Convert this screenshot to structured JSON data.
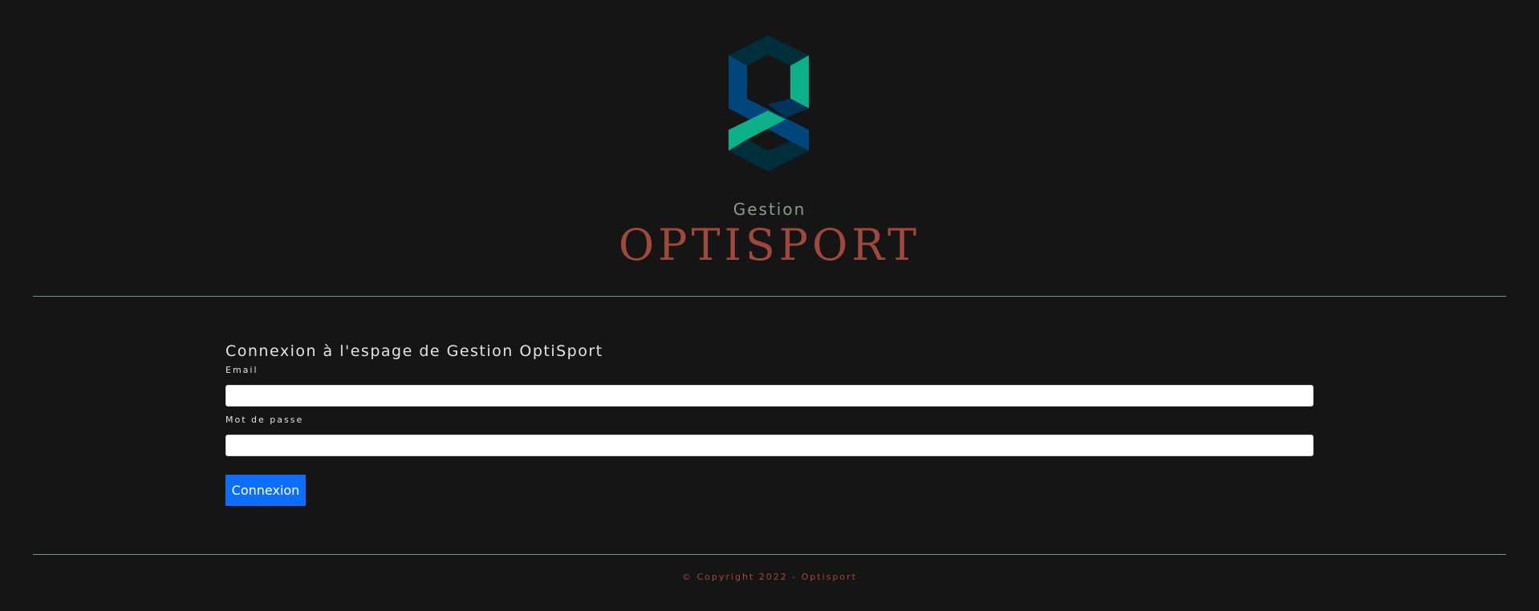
{
  "brand": {
    "subtitle": "Gestion",
    "title": "OPTISPORT",
    "colors": {
      "title": "#a0483c",
      "subtitle": "#8a9a8c",
      "logo_teal": "#0db089",
      "logo_blue": "#00457c",
      "logo_dark": "#002f3c"
    }
  },
  "login": {
    "heading": "Connexion à l'espage de Gestion OptiSport",
    "email_label": "Email",
    "email_value": "",
    "password_label": "Mot de passe",
    "password_value": "",
    "submit_label": "Connexion",
    "submit_color": "#0d6efd"
  },
  "footer": {
    "copyright": "© Copyright 2022 - Optisport"
  },
  "page": {
    "background": "#151515",
    "divider_color": "#6f9a99"
  }
}
